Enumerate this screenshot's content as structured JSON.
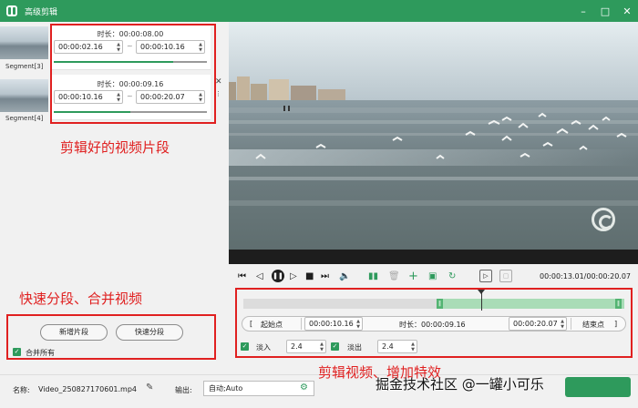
{
  "window": {
    "title": "高级剪辑",
    "minimize": "–",
    "maximize": "□",
    "close": "✕"
  },
  "segments": [
    {
      "label": "Segment[3]",
      "duration": "时长：00:00:08.00",
      "start": "00:00:02.16",
      "end": "00:00:10.16",
      "progress": 0.78
    },
    {
      "label": "Segment[4]",
      "duration": "时长：00:00:09.16",
      "start": "00:00:10.16",
      "end": "00:00:20.07",
      "progress": 0.5
    }
  ],
  "segment_close": "✕",
  "annotations": {
    "segments_note": "剪辑好的视频片段",
    "split_note": "快速分段、合并视频",
    "effects_note": "剪辑视频、增加特效"
  },
  "buttons": {
    "new_segment": "新增片段",
    "quick_split": "快速分段",
    "merge_all": "合并所有"
  },
  "player": {
    "timecode": "00:00:13.01/00:00:20.07",
    "icons": [
      "skip-start-icon",
      "step-back-icon",
      "pause-icon",
      "step-forward-icon",
      "stop-icon",
      "skip-end-icon",
      "volume-icon",
      "split-icon",
      "delete-icon",
      "add-icon",
      "copy-icon",
      "refresh-icon",
      "crop-icon",
      "fit-icon"
    ]
  },
  "trim": {
    "start_label": "起始点",
    "start_value": "00:00:10.16",
    "duration": "时长：00:00:09.16",
    "end_value": "00:00:20.07",
    "end_label": "结束点",
    "fade_in_label": "淡入",
    "fade_in_value": "2.4",
    "fade_out_label": "淡出",
    "fade_out_value": "2.4"
  },
  "bottom": {
    "name_label": "名称:",
    "file_name": "Video_250827170601.mp4",
    "output_label": "输出:",
    "output_value": "自动;Auto"
  },
  "watermark": "掘金技术社区 @一罐小可乐",
  "colors": {
    "accent": "#2e9a5c",
    "annotation": "#e02020"
  }
}
